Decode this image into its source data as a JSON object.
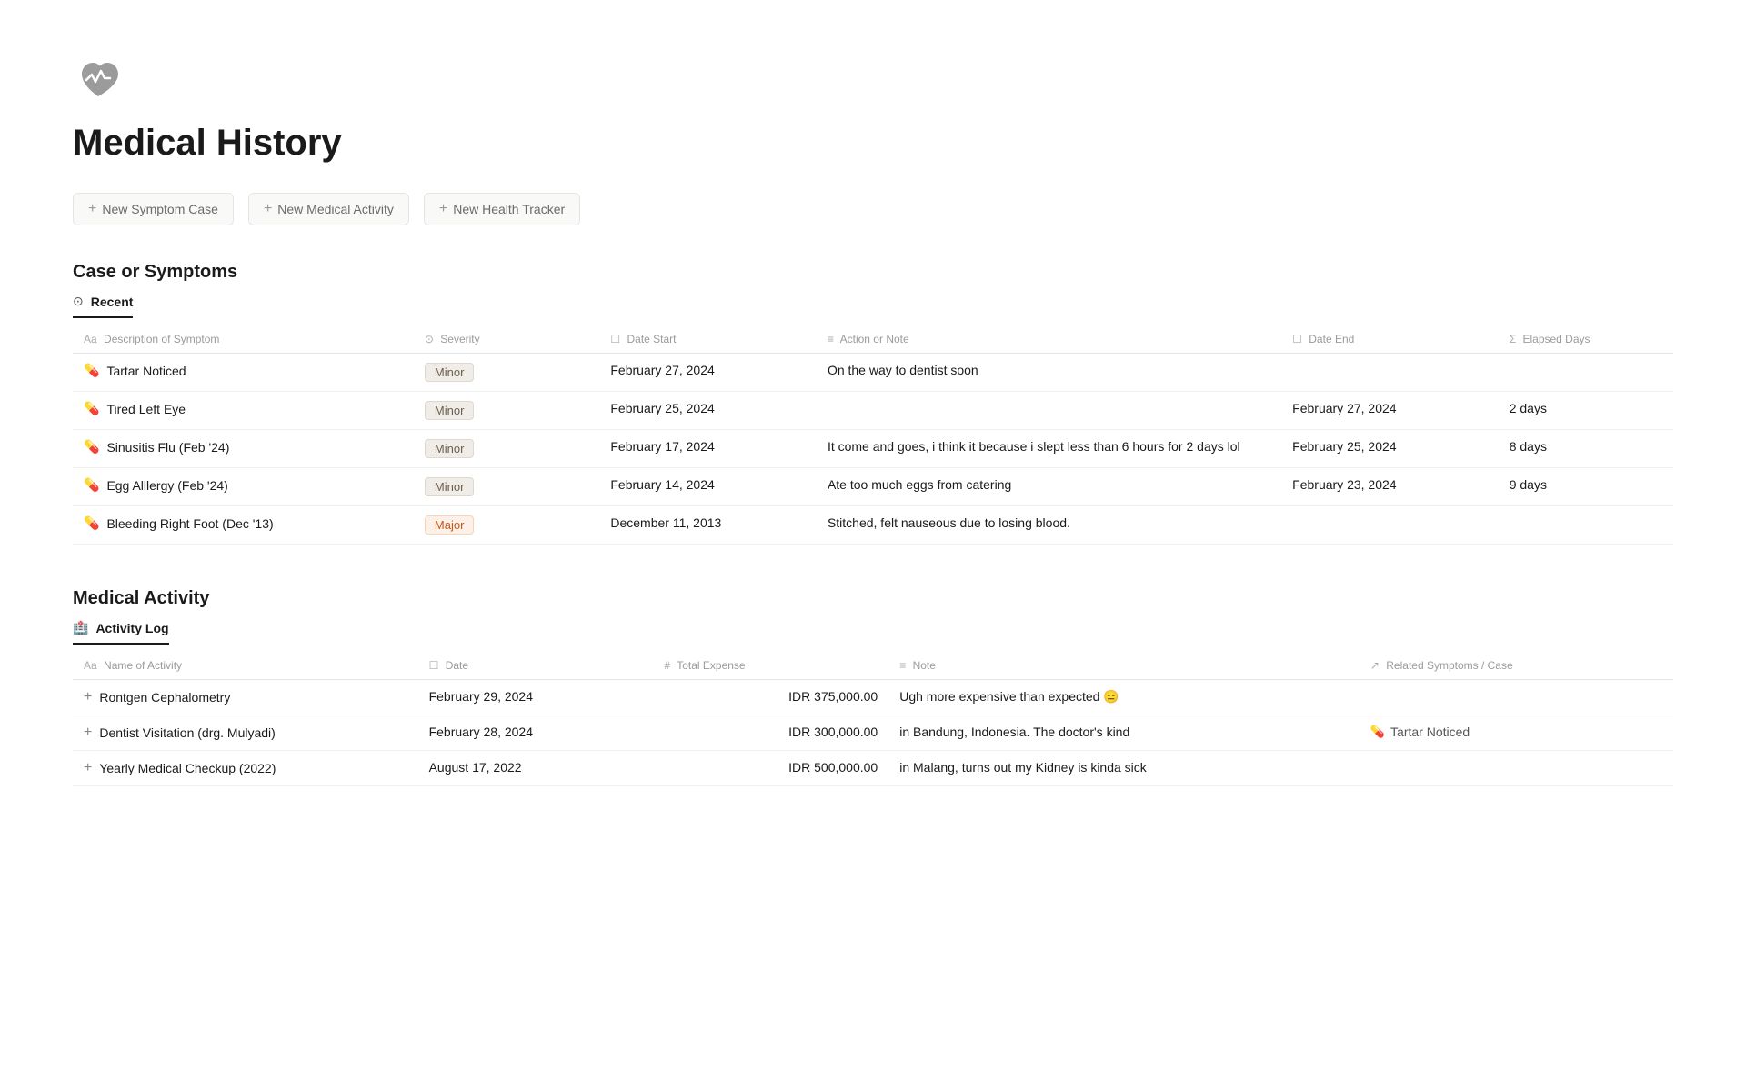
{
  "page": {
    "title": "Medical History",
    "icon_label": "heartbeat-icon"
  },
  "actions": [
    {
      "id": "new-symptom-case",
      "label": "New Symptom Case"
    },
    {
      "id": "new-medical-activity",
      "label": "New Medical Activity"
    },
    {
      "id": "new-health-tracker",
      "label": "New Health Tracker"
    }
  ],
  "symptoms_section": {
    "title": "Case or Symptoms",
    "tab_icon": "⊙",
    "tab_label": "Recent",
    "columns": [
      {
        "icon": "Aa",
        "label": "Description of Symptom"
      },
      {
        "icon": "⊙",
        "label": "Severity"
      },
      {
        "icon": "☐",
        "label": "Date Start"
      },
      {
        "icon": "≡",
        "label": "Action or Note"
      },
      {
        "icon": "☐",
        "label": "Date End"
      },
      {
        "icon": "Σ",
        "label": "Elapsed Days"
      }
    ],
    "rows": [
      {
        "icon": "💊",
        "description": "Tartar Noticed",
        "severity": "Minor",
        "severity_type": "minor",
        "date_start": "February 27, 2024",
        "action_note": "On the way to dentist soon",
        "date_end": "",
        "elapsed_days": ""
      },
      {
        "icon": "💊",
        "description": "Tired Left Eye",
        "severity": "Minor",
        "severity_type": "minor",
        "date_start": "February 25, 2024",
        "action_note": "",
        "date_end": "February 27, 2024",
        "elapsed_days": "2 days"
      },
      {
        "icon": "💊",
        "description": "Sinusitis Flu (Feb '24)",
        "severity": "Minor",
        "severity_type": "minor",
        "date_start": "February 17, 2024",
        "action_note": "It come and goes, i think it because i slept less than 6 hours for 2 days lol",
        "date_end": "February 25, 2024",
        "elapsed_days": "8 days"
      },
      {
        "icon": "💊",
        "description": "Egg Alllergy (Feb '24)",
        "severity": "Minor",
        "severity_type": "minor",
        "date_start": "February 14, 2024",
        "action_note": "Ate too much eggs from catering",
        "date_end": "February 23, 2024",
        "elapsed_days": "9 days"
      },
      {
        "icon": "💊",
        "description": "Bleeding Right Foot (Dec '13)",
        "severity": "Major",
        "severity_type": "major",
        "date_start": "December 11, 2013",
        "action_note": "Stitched, felt nauseous due to losing blood.",
        "date_end": "",
        "elapsed_days": ""
      }
    ]
  },
  "activity_section": {
    "title": "Medical Activity",
    "tab_icon": "🏥",
    "tab_label": "Activity Log",
    "columns": [
      {
        "icon": "Aa",
        "label": "Name of Activity"
      },
      {
        "icon": "☐",
        "label": "Date"
      },
      {
        "icon": "#",
        "label": "Total Expense"
      },
      {
        "icon": "≡",
        "label": "Note"
      },
      {
        "icon": "↗",
        "label": "Related Symptoms / Case"
      }
    ],
    "rows": [
      {
        "icon": "+",
        "name": "Rontgen Cephalometry",
        "date": "February 29, 2024",
        "total_expense": "IDR 375,000.00",
        "note": "Ugh more expensive than expected 😑",
        "related_case": "",
        "related_icon": ""
      },
      {
        "icon": "+",
        "name": "Dentist Visitation (drg. Mulyadi)",
        "date": "February 28, 2024",
        "total_expense": "IDR 300,000.00",
        "note": "in Bandung, Indonesia. The doctor's kind",
        "related_case": "Tartar Noticed",
        "related_icon": "💊"
      },
      {
        "icon": "+",
        "name": "Yearly Medical Checkup (2022)",
        "date": "August 17, 2022",
        "total_expense": "IDR 500,000.00",
        "note": "in Malang, turns out my Kidney is kinda sick",
        "related_case": "",
        "related_icon": ""
      }
    ]
  }
}
